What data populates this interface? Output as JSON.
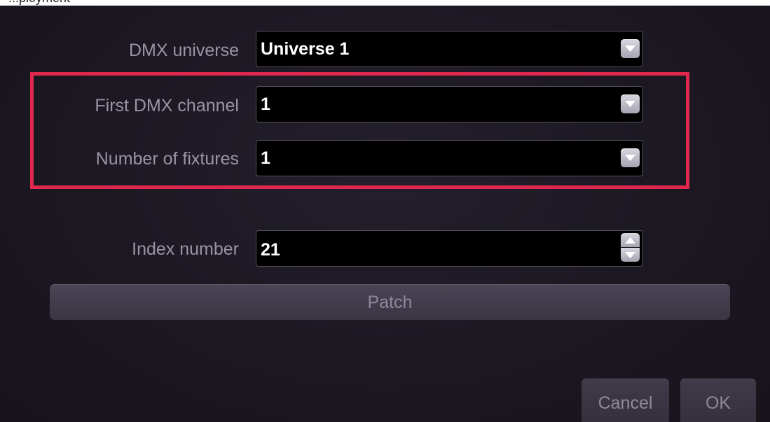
{
  "header": {
    "cut_text": "...ployment"
  },
  "form": {
    "universe": {
      "label": "DMX universe",
      "value": "Universe 1",
      "control_icon": "chevron-down-icon"
    },
    "first_channel": {
      "label": "First DMX channel",
      "value": "1",
      "control_icon": "chevron-down-icon"
    },
    "num_fixtures": {
      "label": "Number of fixtures",
      "value": "1",
      "control_icon": "chevron-down-icon"
    },
    "index_number": {
      "label": "Index number",
      "value": "21",
      "control_icons": [
        "chevron-up-icon",
        "chevron-down-icon"
      ]
    }
  },
  "buttons": {
    "patch": "Patch",
    "cancel": "Cancel",
    "ok": "OK"
  },
  "colors": {
    "highlight": "#e0284f",
    "background": "#1c1822",
    "field_background": "#000000",
    "label_text": "#9a93a5",
    "value_text": "#ffffff"
  }
}
